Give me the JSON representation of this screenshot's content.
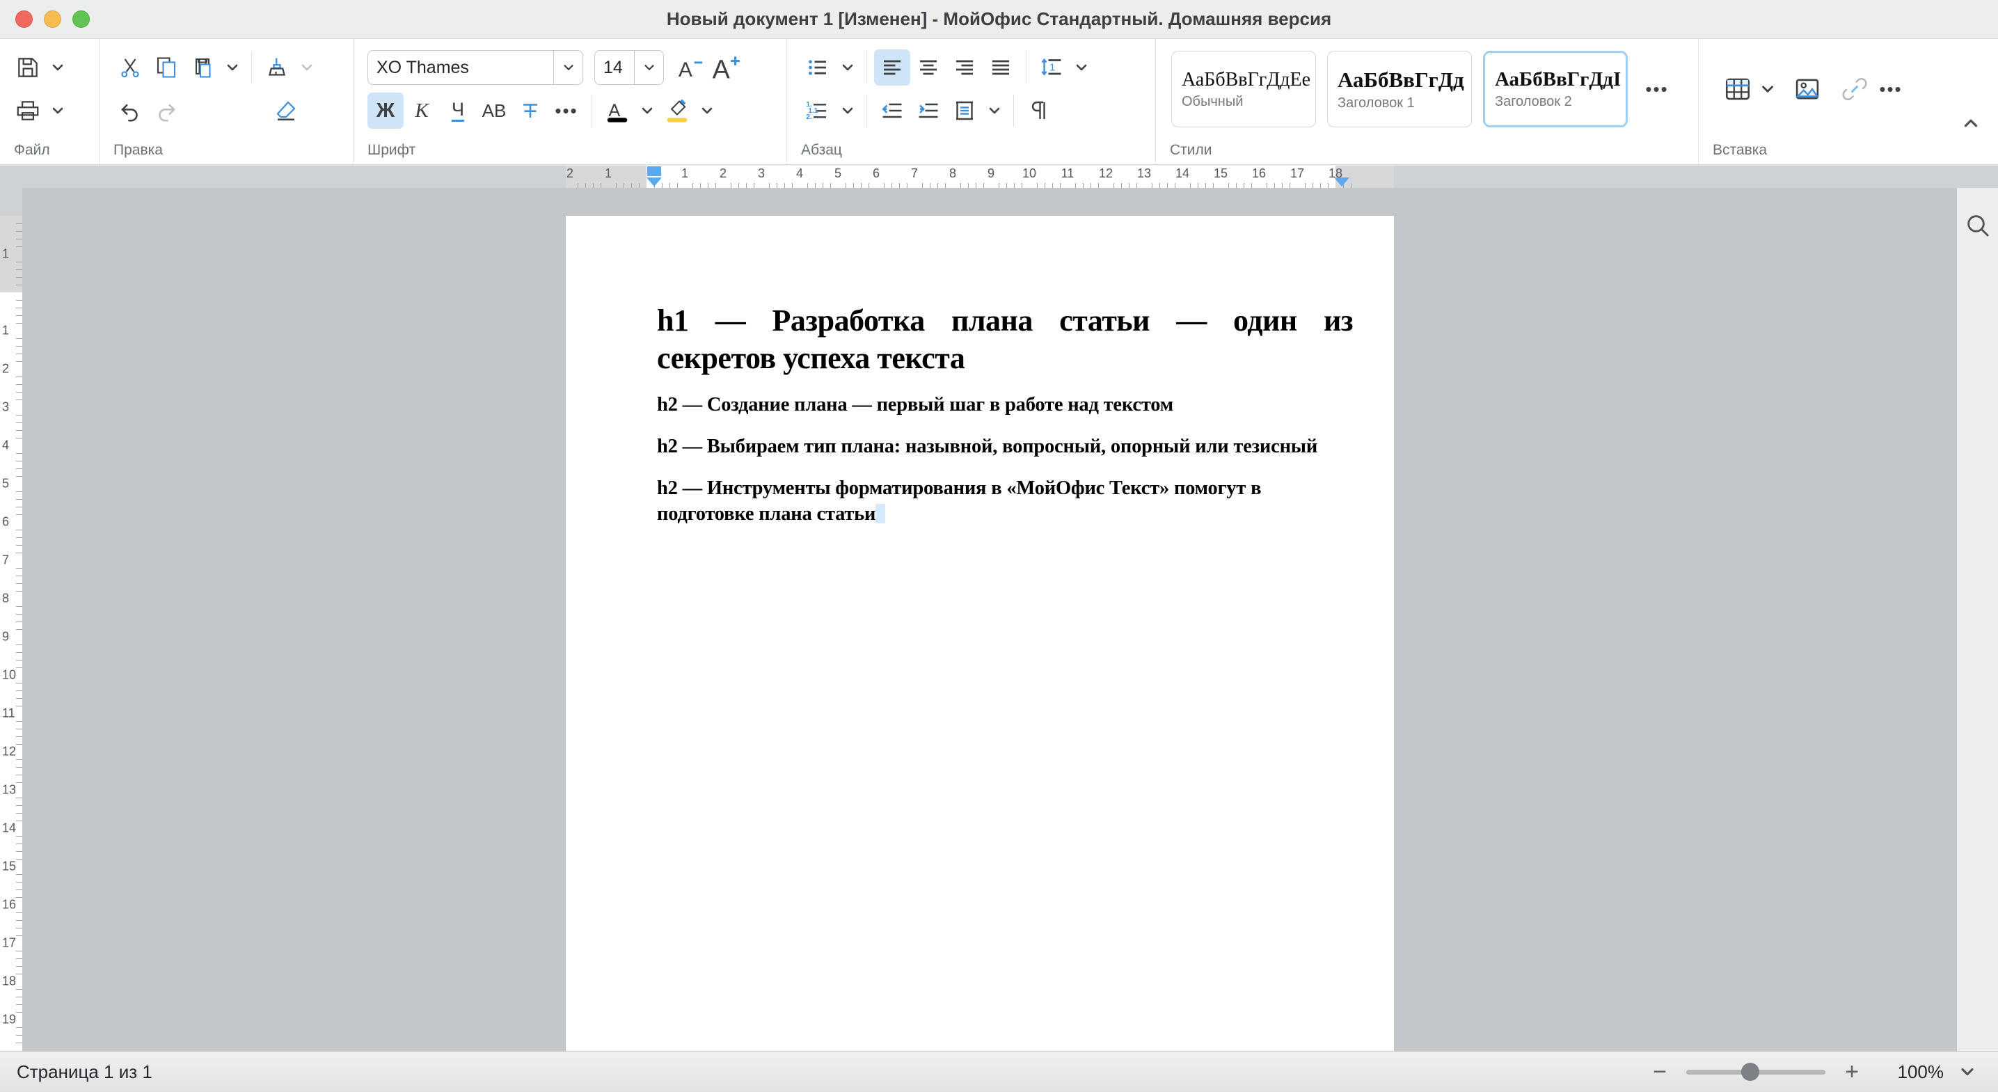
{
  "window": {
    "title": "Новый документ 1 [Изменен] - МойОфис Стандартный. Домашняя версия",
    "controls": {
      "close": "close-button",
      "minimize": "minimize-button",
      "zoom": "maximize-button"
    }
  },
  "toolbar": {
    "groups": [
      {
        "label": "Файл",
        "buttons": [
          "save-icon",
          "save-dropdown",
          "print-icon",
          "print-dropdown"
        ]
      },
      {
        "label": "Правка",
        "buttons": [
          "cut-icon",
          "copy-icon",
          "paste-icon",
          "paste-dropdown",
          "format-painter-icon",
          "format-painter-dropdown",
          "undo-icon",
          "redo-icon",
          "clear-formatting-icon"
        ]
      },
      {
        "label": "Шрифт",
        "font_family": "XO Thames",
        "font_size": "14",
        "decrease_size": "A−",
        "increase_size": "A+",
        "bold": "Ж",
        "italic": "К",
        "underline": "Ч",
        "caps": "АВ",
        "strikethrough": "Ŧ",
        "more": "•••",
        "font_color": "A",
        "font_color_value": "#000000",
        "highlight_color_value": "#f5d046"
      },
      {
        "label": "Абзац",
        "buttons": [
          "bulleted-list-icon",
          "bulleted-list-dropdown",
          "numbered-list-icon",
          "numbered-list-dropdown",
          "align-left-icon",
          "align-center-icon",
          "align-right-icon",
          "align-justify-icon",
          "line-spacing-icon",
          "line-spacing-dropdown",
          "decrease-indent-icon",
          "increase-indent-icon",
          "paragraph-spacing-icon",
          "paragraph-spacing-dropdown",
          "show-formatting-marks-icon"
        ],
        "line_spacing_value": "1"
      },
      {
        "label": "Стили",
        "styles": [
          {
            "sample": "АаБбВвГгДдЕе",
            "name": "Обычный",
            "selected": false
          },
          {
            "sample": "АаБбВвГгДд",
            "name": "Заголовок 1",
            "selected": false
          },
          {
            "sample": "АаБбВвГгДдІ",
            "name": "Заголовок 2",
            "selected": true
          }
        ],
        "more": "•••"
      },
      {
        "label": "Вставка",
        "buttons": [
          "table-icon",
          "table-dropdown",
          "image-icon",
          "link-icon",
          "more-icon"
        ],
        "more": "•••"
      }
    ],
    "collapse": "collapse-ribbon-chevron",
    "accent_color": "#3c8ede",
    "active_bg": "#cfe4f7"
  },
  "rulers": {
    "horizontal_labels": [
      "2",
      "1",
      "1",
      "2",
      "3",
      "4",
      "5",
      "6",
      "7",
      "8",
      "9",
      "10",
      "11",
      "12",
      "13",
      "14",
      "15",
      "16",
      "17",
      "18"
    ],
    "vertical_labels": [
      "1",
      "1",
      "2",
      "3",
      "4",
      "5",
      "6",
      "7",
      "8",
      "9",
      "10",
      "11",
      "12",
      "13",
      "14",
      "15",
      "16",
      "17",
      "18",
      "19"
    ]
  },
  "document": {
    "heading1": "h1 — Разработка плана статьи — один из секретов успеха текста",
    "heading1_line1": "h1 — Разработка плана статьи — один из",
    "heading1_line2": "секретов успеха текста",
    "heading2_items": [
      "h2 — Создание плана — первый шаг в работе над текстом",
      "h2 — Выбираем тип плана: назывной, вопросный, опорный или тезисный",
      "h2 — Инструменты форматирования в «МойОфис Текст» помогут в подготовке плана статьи"
    ]
  },
  "right_panel": {
    "search": "search-icon"
  },
  "statusbar": {
    "page_info": "Страница 1 из 1",
    "zoom_out": "−",
    "zoom_in": "+",
    "zoom_level": "100%",
    "zoom_dropdown": "zoom-dropdown-chevron"
  }
}
